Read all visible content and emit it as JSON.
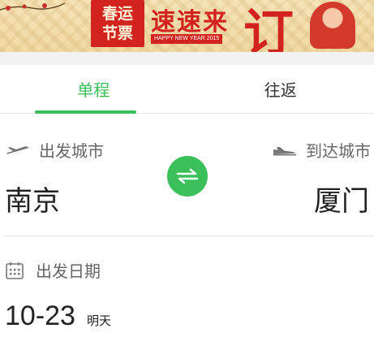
{
  "banner": {
    "box_line1": "春运",
    "box_line2": "节票",
    "slogan": "速速来",
    "big_char": "订",
    "english": "HAPPY NEW YEAR 2015"
  },
  "tabs": [
    {
      "label": "单程",
      "active": true
    },
    {
      "label": "往返",
      "active": false
    }
  ],
  "trip": {
    "depart_label": "出发城市",
    "arrive_label": "到达城市",
    "depart_city": "南京",
    "arrive_city": "厦门"
  },
  "date": {
    "label": "出发日期",
    "value": "10-23",
    "relative": "明天"
  },
  "colors": {
    "accent": "#3bbf5a",
    "banner_red": "#d2231f"
  },
  "icons": [
    "departure-plane-icon",
    "arrival-plane-icon",
    "swap-icon",
    "calendar-icon"
  ]
}
